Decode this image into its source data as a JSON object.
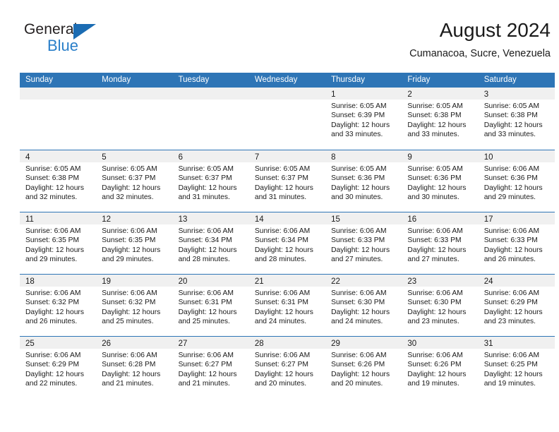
{
  "brand": {
    "name_dark": "General",
    "name_blue": "Blue",
    "accent_color": "#2a7fc9",
    "triangle_color": "#1b6cb3"
  },
  "header": {
    "title": "August 2024",
    "subtitle": "Cumanacoa, Sucre, Venezuela"
  },
  "calendar": {
    "header_bg": "#2e75b6",
    "numband_bg": "#f0f0f0",
    "weekday_labels": [
      "Sunday",
      "Monday",
      "Tuesday",
      "Wednesday",
      "Thursday",
      "Friday",
      "Saturday"
    ],
    "weeks": [
      [
        {
          "day": "",
          "sunrise": "",
          "sunset": "",
          "daylight_l1": "",
          "daylight_l2": ""
        },
        {
          "day": "",
          "sunrise": "",
          "sunset": "",
          "daylight_l1": "",
          "daylight_l2": ""
        },
        {
          "day": "",
          "sunrise": "",
          "sunset": "",
          "daylight_l1": "",
          "daylight_l2": ""
        },
        {
          "day": "",
          "sunrise": "",
          "sunset": "",
          "daylight_l1": "",
          "daylight_l2": ""
        },
        {
          "day": "1",
          "sunrise": "Sunrise: 6:05 AM",
          "sunset": "Sunset: 6:39 PM",
          "daylight_l1": "Daylight: 12 hours",
          "daylight_l2": "and 33 minutes."
        },
        {
          "day": "2",
          "sunrise": "Sunrise: 6:05 AM",
          "sunset": "Sunset: 6:38 PM",
          "daylight_l1": "Daylight: 12 hours",
          "daylight_l2": "and 33 minutes."
        },
        {
          "day": "3",
          "sunrise": "Sunrise: 6:05 AM",
          "sunset": "Sunset: 6:38 PM",
          "daylight_l1": "Daylight: 12 hours",
          "daylight_l2": "and 33 minutes."
        }
      ],
      [
        {
          "day": "4",
          "sunrise": "Sunrise: 6:05 AM",
          "sunset": "Sunset: 6:38 PM",
          "daylight_l1": "Daylight: 12 hours",
          "daylight_l2": "and 32 minutes."
        },
        {
          "day": "5",
          "sunrise": "Sunrise: 6:05 AM",
          "sunset": "Sunset: 6:37 PM",
          "daylight_l1": "Daylight: 12 hours",
          "daylight_l2": "and 32 minutes."
        },
        {
          "day": "6",
          "sunrise": "Sunrise: 6:05 AM",
          "sunset": "Sunset: 6:37 PM",
          "daylight_l1": "Daylight: 12 hours",
          "daylight_l2": "and 31 minutes."
        },
        {
          "day": "7",
          "sunrise": "Sunrise: 6:05 AM",
          "sunset": "Sunset: 6:37 PM",
          "daylight_l1": "Daylight: 12 hours",
          "daylight_l2": "and 31 minutes."
        },
        {
          "day": "8",
          "sunrise": "Sunrise: 6:05 AM",
          "sunset": "Sunset: 6:36 PM",
          "daylight_l1": "Daylight: 12 hours",
          "daylight_l2": "and 30 minutes."
        },
        {
          "day": "9",
          "sunrise": "Sunrise: 6:05 AM",
          "sunset": "Sunset: 6:36 PM",
          "daylight_l1": "Daylight: 12 hours",
          "daylight_l2": "and 30 minutes."
        },
        {
          "day": "10",
          "sunrise": "Sunrise: 6:06 AM",
          "sunset": "Sunset: 6:36 PM",
          "daylight_l1": "Daylight: 12 hours",
          "daylight_l2": "and 29 minutes."
        }
      ],
      [
        {
          "day": "11",
          "sunrise": "Sunrise: 6:06 AM",
          "sunset": "Sunset: 6:35 PM",
          "daylight_l1": "Daylight: 12 hours",
          "daylight_l2": "and 29 minutes."
        },
        {
          "day": "12",
          "sunrise": "Sunrise: 6:06 AM",
          "sunset": "Sunset: 6:35 PM",
          "daylight_l1": "Daylight: 12 hours",
          "daylight_l2": "and 29 minutes."
        },
        {
          "day": "13",
          "sunrise": "Sunrise: 6:06 AM",
          "sunset": "Sunset: 6:34 PM",
          "daylight_l1": "Daylight: 12 hours",
          "daylight_l2": "and 28 minutes."
        },
        {
          "day": "14",
          "sunrise": "Sunrise: 6:06 AM",
          "sunset": "Sunset: 6:34 PM",
          "daylight_l1": "Daylight: 12 hours",
          "daylight_l2": "and 28 minutes."
        },
        {
          "day": "15",
          "sunrise": "Sunrise: 6:06 AM",
          "sunset": "Sunset: 6:33 PM",
          "daylight_l1": "Daylight: 12 hours",
          "daylight_l2": "and 27 minutes."
        },
        {
          "day": "16",
          "sunrise": "Sunrise: 6:06 AM",
          "sunset": "Sunset: 6:33 PM",
          "daylight_l1": "Daylight: 12 hours",
          "daylight_l2": "and 27 minutes."
        },
        {
          "day": "17",
          "sunrise": "Sunrise: 6:06 AM",
          "sunset": "Sunset: 6:33 PM",
          "daylight_l1": "Daylight: 12 hours",
          "daylight_l2": "and 26 minutes."
        }
      ],
      [
        {
          "day": "18",
          "sunrise": "Sunrise: 6:06 AM",
          "sunset": "Sunset: 6:32 PM",
          "daylight_l1": "Daylight: 12 hours",
          "daylight_l2": "and 26 minutes."
        },
        {
          "day": "19",
          "sunrise": "Sunrise: 6:06 AM",
          "sunset": "Sunset: 6:32 PM",
          "daylight_l1": "Daylight: 12 hours",
          "daylight_l2": "and 25 minutes."
        },
        {
          "day": "20",
          "sunrise": "Sunrise: 6:06 AM",
          "sunset": "Sunset: 6:31 PM",
          "daylight_l1": "Daylight: 12 hours",
          "daylight_l2": "and 25 minutes."
        },
        {
          "day": "21",
          "sunrise": "Sunrise: 6:06 AM",
          "sunset": "Sunset: 6:31 PM",
          "daylight_l1": "Daylight: 12 hours",
          "daylight_l2": "and 24 minutes."
        },
        {
          "day": "22",
          "sunrise": "Sunrise: 6:06 AM",
          "sunset": "Sunset: 6:30 PM",
          "daylight_l1": "Daylight: 12 hours",
          "daylight_l2": "and 24 minutes."
        },
        {
          "day": "23",
          "sunrise": "Sunrise: 6:06 AM",
          "sunset": "Sunset: 6:30 PM",
          "daylight_l1": "Daylight: 12 hours",
          "daylight_l2": "and 23 minutes."
        },
        {
          "day": "24",
          "sunrise": "Sunrise: 6:06 AM",
          "sunset": "Sunset: 6:29 PM",
          "daylight_l1": "Daylight: 12 hours",
          "daylight_l2": "and 23 minutes."
        }
      ],
      [
        {
          "day": "25",
          "sunrise": "Sunrise: 6:06 AM",
          "sunset": "Sunset: 6:29 PM",
          "daylight_l1": "Daylight: 12 hours",
          "daylight_l2": "and 22 minutes."
        },
        {
          "day": "26",
          "sunrise": "Sunrise: 6:06 AM",
          "sunset": "Sunset: 6:28 PM",
          "daylight_l1": "Daylight: 12 hours",
          "daylight_l2": "and 21 minutes."
        },
        {
          "day": "27",
          "sunrise": "Sunrise: 6:06 AM",
          "sunset": "Sunset: 6:27 PM",
          "daylight_l1": "Daylight: 12 hours",
          "daylight_l2": "and 21 minutes."
        },
        {
          "day": "28",
          "sunrise": "Sunrise: 6:06 AM",
          "sunset": "Sunset: 6:27 PM",
          "daylight_l1": "Daylight: 12 hours",
          "daylight_l2": "and 20 minutes."
        },
        {
          "day": "29",
          "sunrise": "Sunrise: 6:06 AM",
          "sunset": "Sunset: 6:26 PM",
          "daylight_l1": "Daylight: 12 hours",
          "daylight_l2": "and 20 minutes."
        },
        {
          "day": "30",
          "sunrise": "Sunrise: 6:06 AM",
          "sunset": "Sunset: 6:26 PM",
          "daylight_l1": "Daylight: 12 hours",
          "daylight_l2": "and 19 minutes."
        },
        {
          "day": "31",
          "sunrise": "Sunrise: 6:06 AM",
          "sunset": "Sunset: 6:25 PM",
          "daylight_l1": "Daylight: 12 hours",
          "daylight_l2": "and 19 minutes."
        }
      ]
    ]
  }
}
